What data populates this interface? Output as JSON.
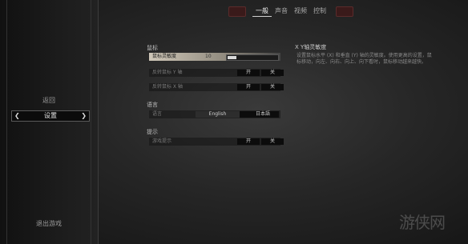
{
  "tabs": {
    "items": [
      "一般",
      "声音",
      "视频",
      "控制"
    ],
    "active_index": 0
  },
  "sidebar": {
    "back": "返回",
    "settings": "设置",
    "quit": "退出游戏"
  },
  "sections": {
    "mouse": {
      "title": "鼠标",
      "sensitivity_label": "鼠标灵敏度",
      "sensitivity_value": "10",
      "sensitivity_level": 0.18,
      "invert_y_label": "反转鼠标 Y 轴",
      "invert_x_label": "反转鼠标 X 轴"
    },
    "language": {
      "title": "语言",
      "label": "语言",
      "options": [
        "English",
        "日本語"
      ]
    },
    "hints": {
      "title": "提示",
      "label": "游戏提示"
    }
  },
  "toggle": {
    "on": "开",
    "off": "关"
  },
  "info": {
    "title": "X Y轴灵敏度",
    "text": "设置鼠标水平 (X) 和垂直 (Y) 轴的灵敏度。使用更高的设置，鼠标移动，向左、向右、向上、向下看时，鼠标移动越来越快。"
  },
  "watermark": "游侠网",
  "colors": {
    "active_row": "#cfc7b8",
    "tab_arrow": "#3a1a1a"
  }
}
